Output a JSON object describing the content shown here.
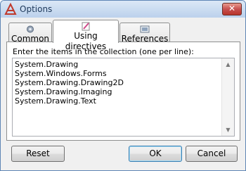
{
  "window": {
    "title": "Options"
  },
  "tabs": [
    {
      "label": "Common",
      "icon": "gear-icon",
      "active": false
    },
    {
      "label": "Using directives",
      "icon": "pencil-icon",
      "active": true
    },
    {
      "label": "References",
      "icon": "references-icon",
      "active": false
    }
  ],
  "panel": {
    "instruction": "Enter the items in the collection (one per line):",
    "items": [
      "System.Drawing",
      "System.Windows.Forms",
      "System.Drawing.Drawing2D",
      "System.Drawing.Imaging",
      "System.Drawing.Text"
    ]
  },
  "buttons": {
    "reset": "Reset",
    "ok": "OK",
    "cancel": "Cancel"
  },
  "colors": {
    "accent": "#3c7fb1",
    "close": "#c75050",
    "title_text": "#1e395b"
  }
}
